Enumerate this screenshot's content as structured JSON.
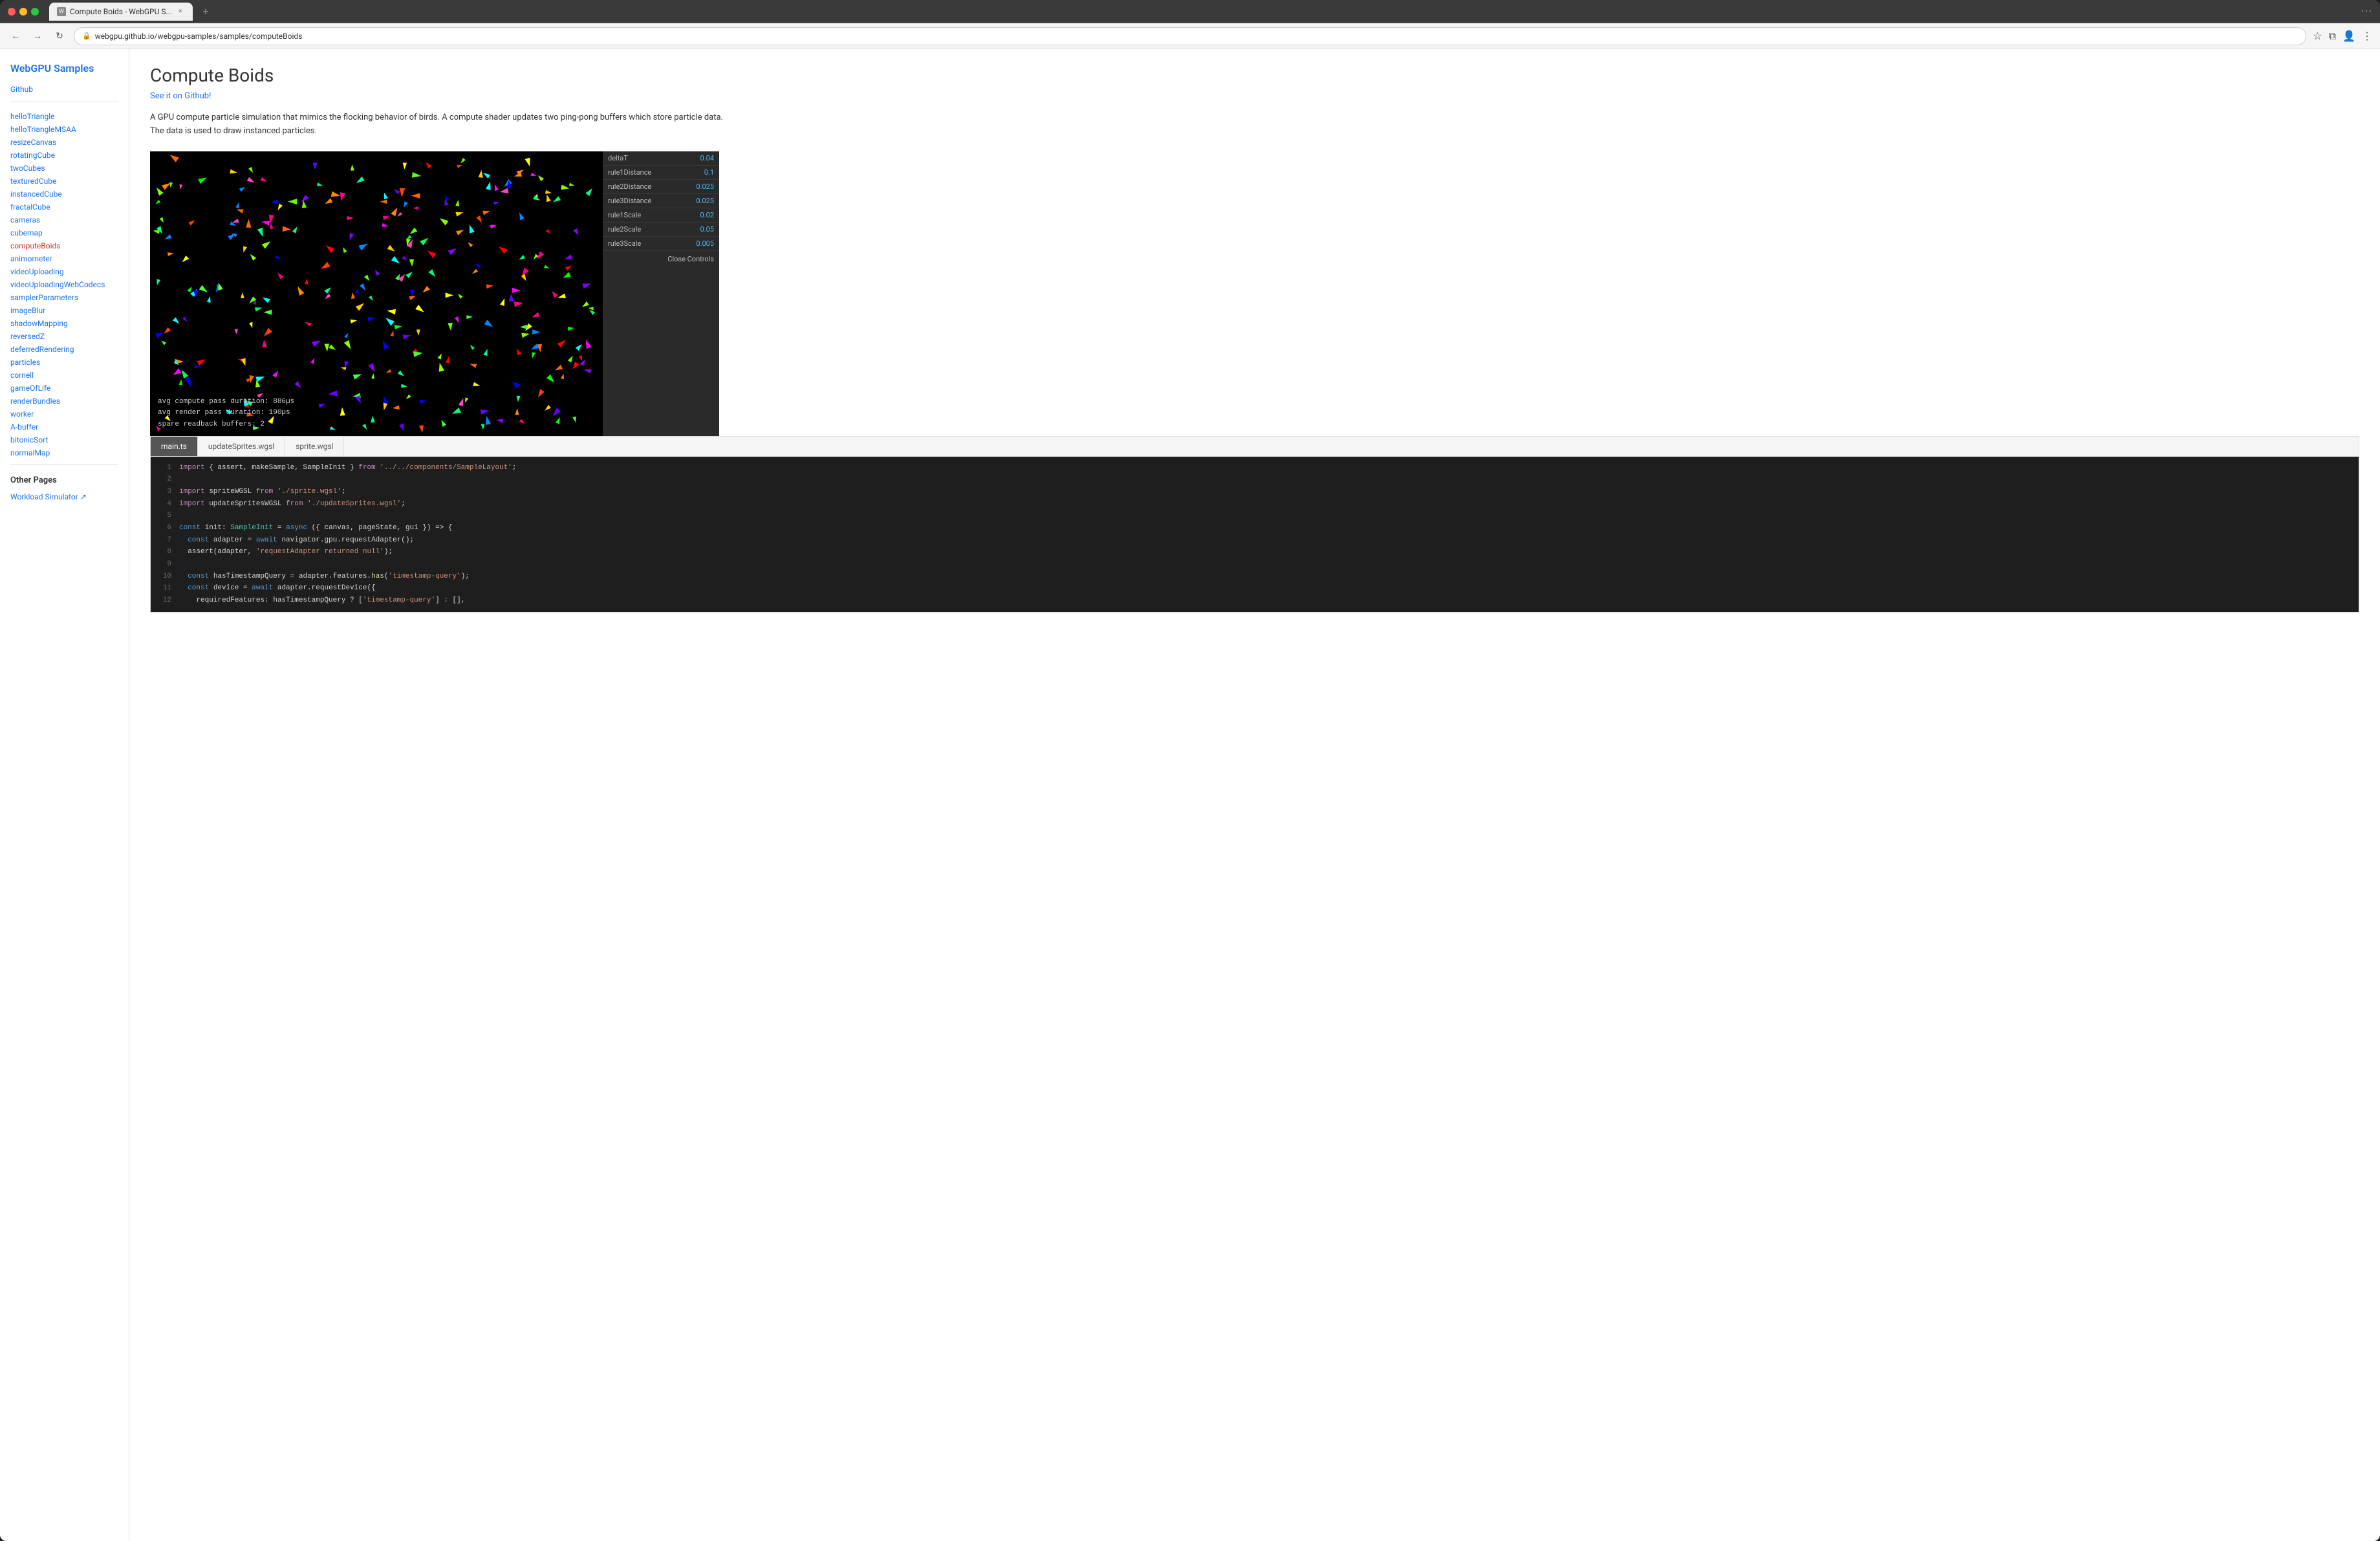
{
  "browser": {
    "tab_title": "Compute Boids - WebGPU S...",
    "url": "webgpu.github.io/webgpu-samples/samples/computeBoids",
    "new_tab_label": "+",
    "close_tab_label": "×"
  },
  "sidebar": {
    "brand": "WebGPU Samples",
    "github_link": "Github",
    "nav_items": [
      {
        "label": "helloTriangle",
        "active": false
      },
      {
        "label": "helloTriangleMSAA",
        "active": false
      },
      {
        "label": "resizeCanvas",
        "active": false
      },
      {
        "label": "rotatingCube",
        "active": false
      },
      {
        "label": "twoCubes",
        "active": false
      },
      {
        "label": "texturedCube",
        "active": false
      },
      {
        "label": "instancedCube",
        "active": false
      },
      {
        "label": "fractalCube",
        "active": false
      },
      {
        "label": "cameras",
        "active": false
      },
      {
        "label": "cubemap",
        "active": false
      },
      {
        "label": "computeBoids",
        "active": true
      },
      {
        "label": "animometer",
        "active": false
      },
      {
        "label": "videoUploading",
        "active": false
      },
      {
        "label": "videoUploadingWebCodecs",
        "active": false
      },
      {
        "label": "samplerParameters",
        "active": false
      },
      {
        "label": "imageBlur",
        "active": false
      },
      {
        "label": "shadowMapping",
        "active": false
      },
      {
        "label": "reversedZ",
        "active": false
      },
      {
        "label": "deferredRendering",
        "active": false
      },
      {
        "label": "particles",
        "active": false
      },
      {
        "label": "cornell",
        "active": false
      },
      {
        "label": "gameOfLife",
        "active": false
      },
      {
        "label": "renderBundles",
        "active": false
      },
      {
        "label": "worker",
        "active": false
      },
      {
        "label": "A-buffer",
        "active": false
      },
      {
        "label": "bitonicSort",
        "active": false
      },
      {
        "label": "normalMap",
        "active": false
      }
    ],
    "other_pages_title": "Other Pages",
    "other_pages": [
      {
        "label": "Workload Simulator ↗"
      }
    ]
  },
  "main": {
    "title": "Compute Boids",
    "github_link": "See it on Github!",
    "description": "A GPU compute particle simulation that mimics the flocking behavior of birds. A compute shader updates two ping-pong buffers which store particle data. The data is used to draw instanced particles.",
    "stats": {
      "compute_pass": "avg compute pass duration:  886µs",
      "render_pass": "avg render pass duration:   190µs",
      "spare_buffers": "spare readback buffers:    2"
    },
    "controls": {
      "title": "Controls",
      "close_label": "Close Controls",
      "params": [
        {
          "label": "deltaT",
          "value": "0.04"
        },
        {
          "label": "rule1Distance",
          "value": "0.1"
        },
        {
          "label": "rule2Distance",
          "value": "0.025"
        },
        {
          "label": "rule3Distance",
          "value": "0.025"
        },
        {
          "label": "rule1Scale",
          "value": "0.02"
        },
        {
          "label": "rule2Scale",
          "value": "0.05"
        },
        {
          "label": "rule3Scale",
          "value": "0.005"
        }
      ]
    },
    "code_tabs": [
      {
        "label": "main.ts",
        "active": true
      },
      {
        "label": "updateSprites.wgsl",
        "active": false
      },
      {
        "label": "sprite.wgsl",
        "active": false
      }
    ],
    "code_lines": [
      {
        "num": "1",
        "tokens": [
          {
            "cls": "c-import",
            "t": "import"
          },
          {
            "cls": "",
            "t": " { assert, makeSample, SampleInit } "
          },
          {
            "cls": "c-from",
            "t": "from"
          },
          {
            "cls": "",
            "t": " "
          },
          {
            "cls": "c-string",
            "t": "'../../components/SampleLayout'"
          },
          {
            "cls": "",
            "t": ";"
          }
        ]
      },
      {
        "num": "2",
        "tokens": []
      },
      {
        "num": "3",
        "tokens": [
          {
            "cls": "c-import",
            "t": "import"
          },
          {
            "cls": "",
            "t": " spriteWGSL "
          },
          {
            "cls": "c-from",
            "t": "from"
          },
          {
            "cls": "",
            "t": " "
          },
          {
            "cls": "c-string",
            "t": "'./sprite.wgsl'"
          },
          {
            "cls": "",
            "t": ";"
          }
        ]
      },
      {
        "num": "4",
        "tokens": [
          {
            "cls": "c-import",
            "t": "import"
          },
          {
            "cls": "",
            "t": " updateSpritesWGSL "
          },
          {
            "cls": "c-from",
            "t": "from"
          },
          {
            "cls": "",
            "t": " "
          },
          {
            "cls": "c-string",
            "t": "'./updateSprites.wgsl'"
          },
          {
            "cls": "",
            "t": ";"
          }
        ]
      },
      {
        "num": "5",
        "tokens": []
      },
      {
        "num": "6",
        "tokens": [
          {
            "cls": "c-const",
            "t": "const"
          },
          {
            "cls": "",
            "t": " init: "
          },
          {
            "cls": "c-type",
            "t": "SampleInit"
          },
          {
            "cls": "",
            "t": " = "
          },
          {
            "cls": "c-async",
            "t": "async"
          },
          {
            "cls": "",
            "t": " ({ canvas, pageState, gui }) => {"
          }
        ]
      },
      {
        "num": "7",
        "tokens": [
          {
            "cls": "",
            "t": "  "
          },
          {
            "cls": "c-const",
            "t": "const"
          },
          {
            "cls": "",
            "t": " adapter = "
          },
          {
            "cls": "c-await",
            "t": "await"
          },
          {
            "cls": "",
            "t": " navigator.gpu.requestAdapter();"
          }
        ]
      },
      {
        "num": "8",
        "tokens": [
          {
            "cls": "",
            "t": "  assert(adapter, "
          },
          {
            "cls": "c-string",
            "t": "'requestAdapter returned null'"
          },
          {
            "cls": "",
            "t": ");"
          }
        ]
      },
      {
        "num": "9",
        "tokens": []
      },
      {
        "num": "10",
        "tokens": [
          {
            "cls": "",
            "t": "  "
          },
          {
            "cls": "c-const",
            "t": "const"
          },
          {
            "cls": "",
            "t": " hasTimestampQuery = adapter.features."
          },
          {
            "cls": "c-has",
            "t": "has"
          },
          {
            "cls": "",
            "t": "("
          },
          {
            "cls": "c-string",
            "t": "'timestamp-query'"
          },
          {
            "cls": "",
            "t": ");"
          }
        ]
      },
      {
        "num": "11",
        "tokens": [
          {
            "cls": "",
            "t": "  "
          },
          {
            "cls": "c-const",
            "t": "const"
          },
          {
            "cls": "",
            "t": " device = "
          },
          {
            "cls": "c-await",
            "t": "await"
          },
          {
            "cls": "",
            "t": " adapter.requestDevice({"
          }
        ]
      },
      {
        "num": "12",
        "tokens": [
          {
            "cls": "",
            "t": "    requiredFeatures: hasTimestampQuery ? ["
          },
          {
            "cls": "c-string",
            "t": "'timestamp-query'"
          },
          {
            "cls": "",
            "t": "} : [],"
          }
        ]
      }
    ]
  }
}
